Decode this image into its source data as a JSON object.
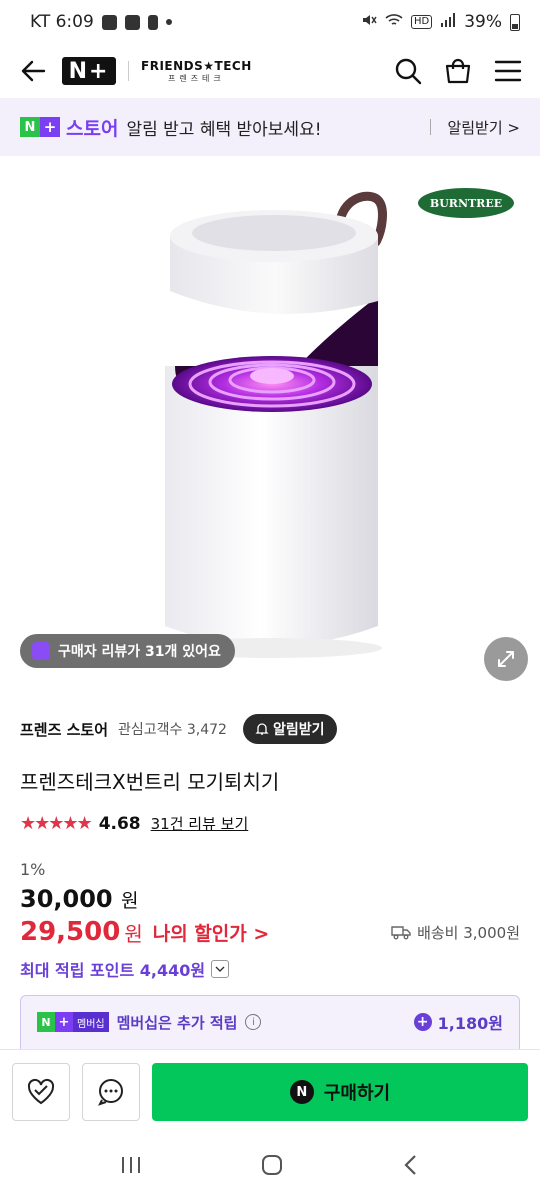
{
  "status": {
    "carrier_time": "KT 6:09",
    "hd": "HD",
    "battery": "39%"
  },
  "header": {
    "logo": "N+",
    "brand_en": "FRIENDS★TECH",
    "brand_ko": "프렌즈테크"
  },
  "banner": {
    "store_label": "스토어",
    "message": "알림 받고 혜택 받아보세요!",
    "action": "알림받기 >"
  },
  "hero": {
    "brand_badge": "BURNTREE",
    "review_notice": "구매자 리뷰가 31개 있어요"
  },
  "seller": {
    "name": "프렌즈 스토어",
    "followers": "관심고객수 3,472",
    "alarm_button": "알림받기"
  },
  "product": {
    "title": "프렌즈테크X번트리 모기퇴치기",
    "stars": "★★★★★",
    "rating": "4.68",
    "review_link": "31건 리뷰 보기",
    "discount": "1%",
    "original_price": "30,000",
    "original_won": "원",
    "sale_price": "29,500",
    "sale_won": "원",
    "sale_label": "나의 할인가 >",
    "shipping": "배송비 3,000원",
    "points": "최대 적립 포인트 4,440원"
  },
  "membership": {
    "tag": "멤버십",
    "message": "멤버십은 추가 적립",
    "points": "1,180원"
  },
  "bottom": {
    "buy_label": "구매하기",
    "n_mark": "N"
  },
  "colors": {
    "accent_purple": "#7a3ff2",
    "naver_green": "#03c75a",
    "sale_red": "#e0283a"
  }
}
